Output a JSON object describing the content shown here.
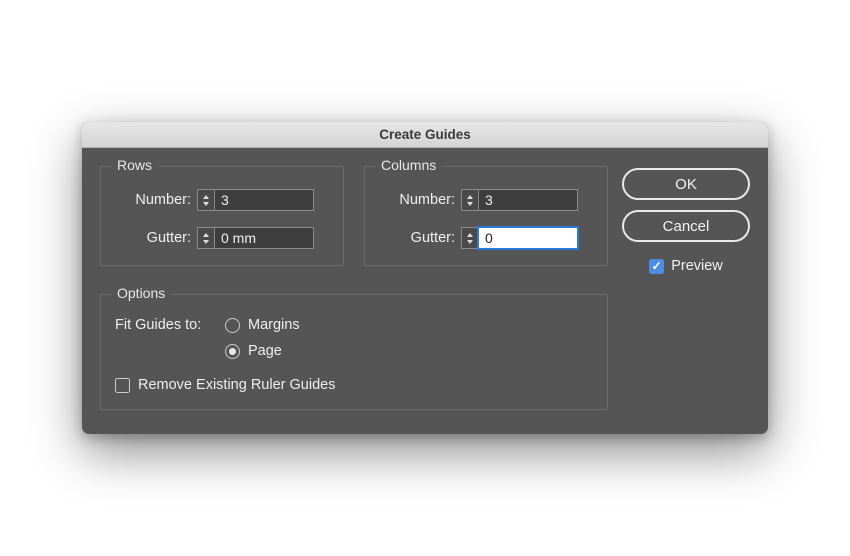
{
  "dialog": {
    "title": "Create Guides",
    "buttons": {
      "ok": "OK",
      "cancel": "Cancel"
    },
    "preview": {
      "label": "Preview",
      "checked": true
    }
  },
  "rows": {
    "legend": "Rows",
    "number_label": "Number:",
    "number_value": "3",
    "gutter_label": "Gutter:",
    "gutter_value": "0 mm"
  },
  "columns": {
    "legend": "Columns",
    "number_label": "Number:",
    "number_value": "3",
    "gutter_label": "Gutter:",
    "gutter_value": "0"
  },
  "options": {
    "legend": "Options",
    "fit_label": "Fit Guides to:",
    "margins_label": "Margins",
    "page_label": "Page",
    "selected": "page",
    "remove_label": "Remove Existing Ruler Guides",
    "remove_checked": false
  }
}
